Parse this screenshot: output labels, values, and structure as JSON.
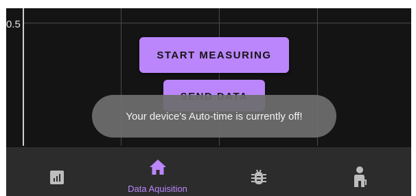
{
  "chart": {
    "y_tick_label": "0.5"
  },
  "actions": {
    "start_label": "START MEASURING",
    "send_label": "SEND DATA"
  },
  "toast": {
    "message": "Your device's Auto-time is currently off!"
  },
  "bottom_nav": {
    "items": [
      {
        "icon": "chart-icon",
        "label": ""
      },
      {
        "icon": "home-icon",
        "label": "Data Aquisition",
        "active": true
      },
      {
        "icon": "bug-icon",
        "label": ""
      },
      {
        "icon": "person-icon",
        "label": ""
      }
    ]
  },
  "colors": {
    "accent": "#bb86fc",
    "background": "#141414",
    "nav_background": "#2c2c2c",
    "inactive_icon": "#bdbdbd"
  }
}
